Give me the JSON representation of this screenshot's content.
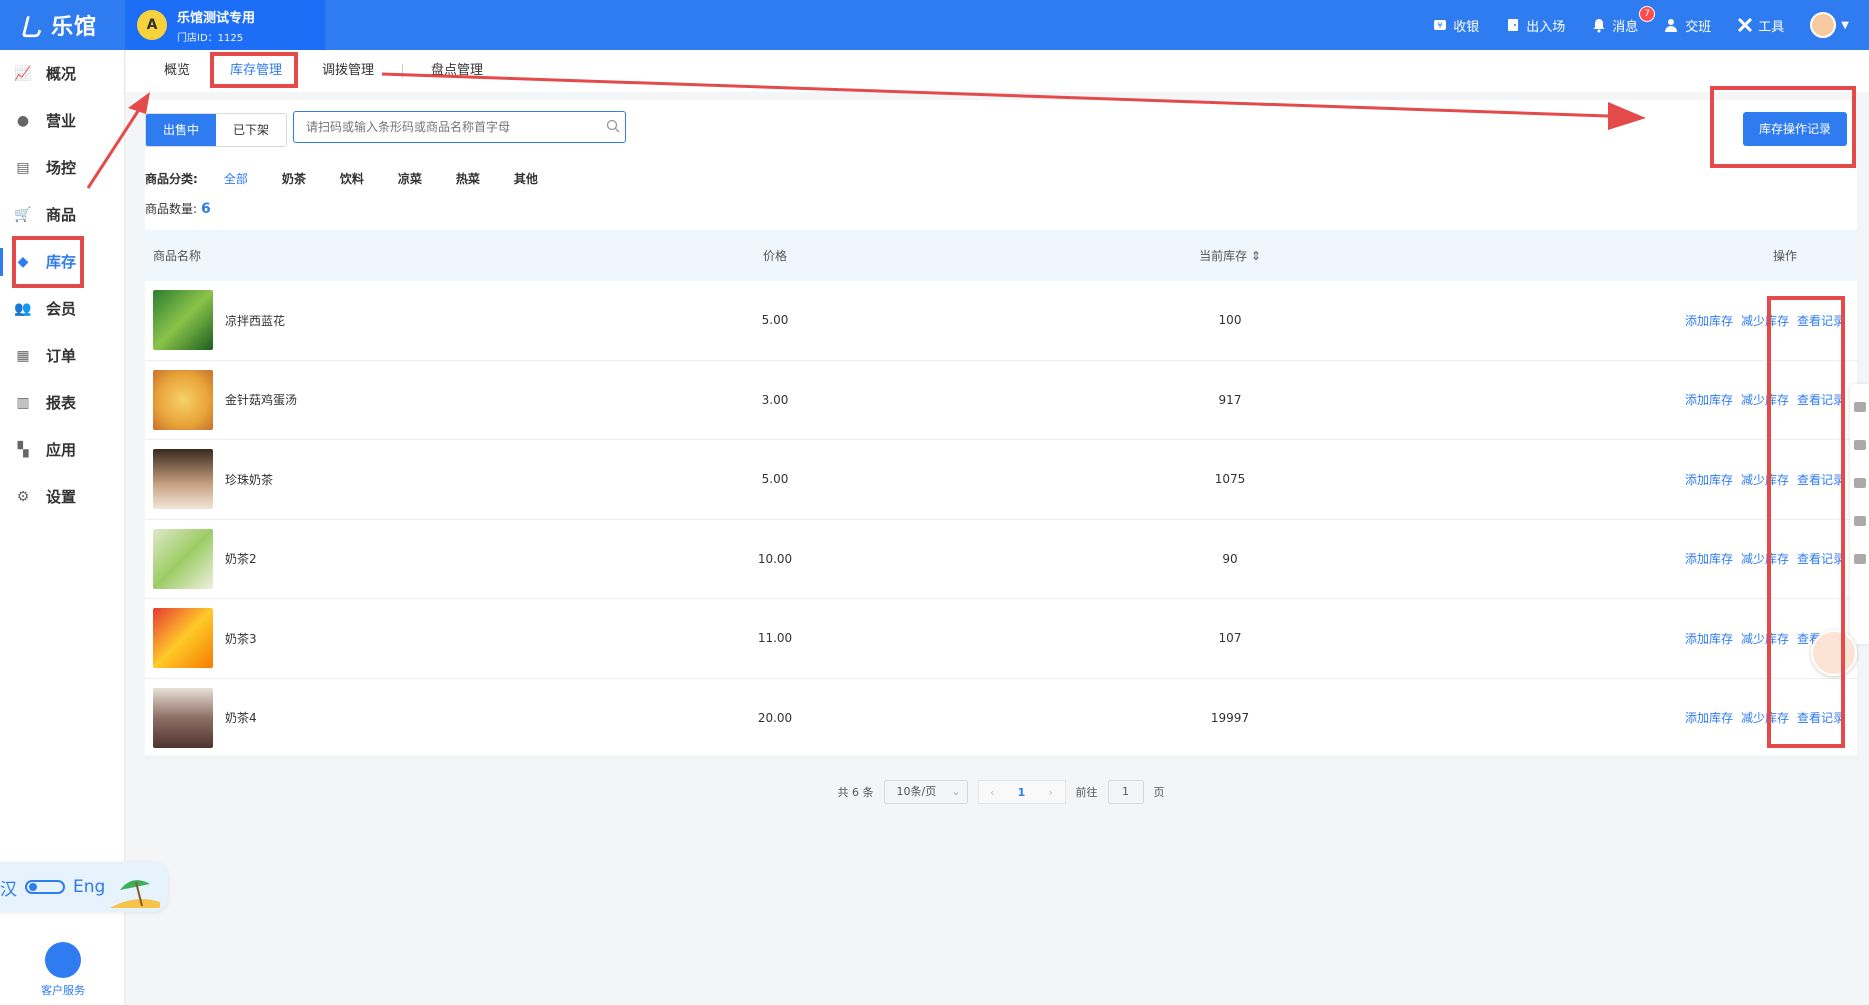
{
  "topbar": {
    "logo_mark": "乚",
    "logo_text": "乐馆",
    "store_avatar": "A",
    "store_name": "乐馆测试专用",
    "store_id": "门店ID：1125",
    "actions": [
      {
        "label": "收银",
        "icon": "cashier-icon"
      },
      {
        "label": "出入场",
        "icon": "door-icon"
      },
      {
        "label": "消息",
        "icon": "bell-icon",
        "badge": "7"
      },
      {
        "label": "交班",
        "icon": "handover-icon"
      },
      {
        "label": "工具",
        "icon": "tools-icon"
      }
    ]
  },
  "sidebar": {
    "items": [
      {
        "label": "概况",
        "icon": "chart-icon"
      },
      {
        "label": "营业",
        "icon": "bag-icon"
      },
      {
        "label": "场控",
        "icon": "room-icon"
      },
      {
        "label": "商品",
        "icon": "cart-icon"
      },
      {
        "label": "库存",
        "icon": "layers-icon",
        "active": true
      },
      {
        "label": "会员",
        "icon": "members-icon"
      },
      {
        "label": "订单",
        "icon": "order-icon"
      },
      {
        "label": "报表",
        "icon": "report-icon"
      },
      {
        "label": "应用",
        "icon": "apps-icon"
      },
      {
        "label": "设置",
        "icon": "gear-icon"
      }
    ],
    "lang_left": "汉",
    "lang_right": "Eng",
    "customer_service": "客户服务"
  },
  "tabs": [
    "概览",
    "库存管理",
    "调拨管理",
    "盘点管理"
  ],
  "toolbar": {
    "seg_on_sale": "出售中",
    "seg_off_shelf": "已下架",
    "search_placeholder": "请扫码或输入条形码或商品名称首字母",
    "log_button": "库存操作记录"
  },
  "categories": {
    "label": "商品分类:",
    "items": [
      "全部",
      "奶茶",
      "饮料",
      "凉菜",
      "热菜",
      "其他"
    ]
  },
  "count_label": "商品数量:",
  "count_value": "6",
  "table": {
    "headers": {
      "name": "商品名称",
      "price": "价格",
      "stock": "当前库存 ⇕",
      "ops": "操作"
    },
    "rows": [
      {
        "name": "凉拌西蓝花",
        "price": "5.00",
        "stock": "100"
      },
      {
        "name": "金针菇鸡蛋汤",
        "price": "3.00",
        "stock": "917"
      },
      {
        "name": "珍珠奶茶",
        "price": "5.00",
        "stock": "1075"
      },
      {
        "name": "奶茶2",
        "price": "10.00",
        "stock": "90"
      },
      {
        "name": "奶茶3",
        "price": "11.00",
        "stock": "107"
      },
      {
        "name": "奶茶4",
        "price": "20.00",
        "stock": "19997"
      }
    ],
    "op_add": "添加库存",
    "op_reduce": "减少库存",
    "op_view": "查看记录"
  },
  "pager": {
    "total": "共 6 条",
    "per_page": "10条/页",
    "current": "1",
    "goto_label": "前往",
    "goto_value": "1",
    "page_unit": "页"
  },
  "colors": {
    "brand": "#2f7bf0",
    "annotation": "#e54a4a"
  }
}
